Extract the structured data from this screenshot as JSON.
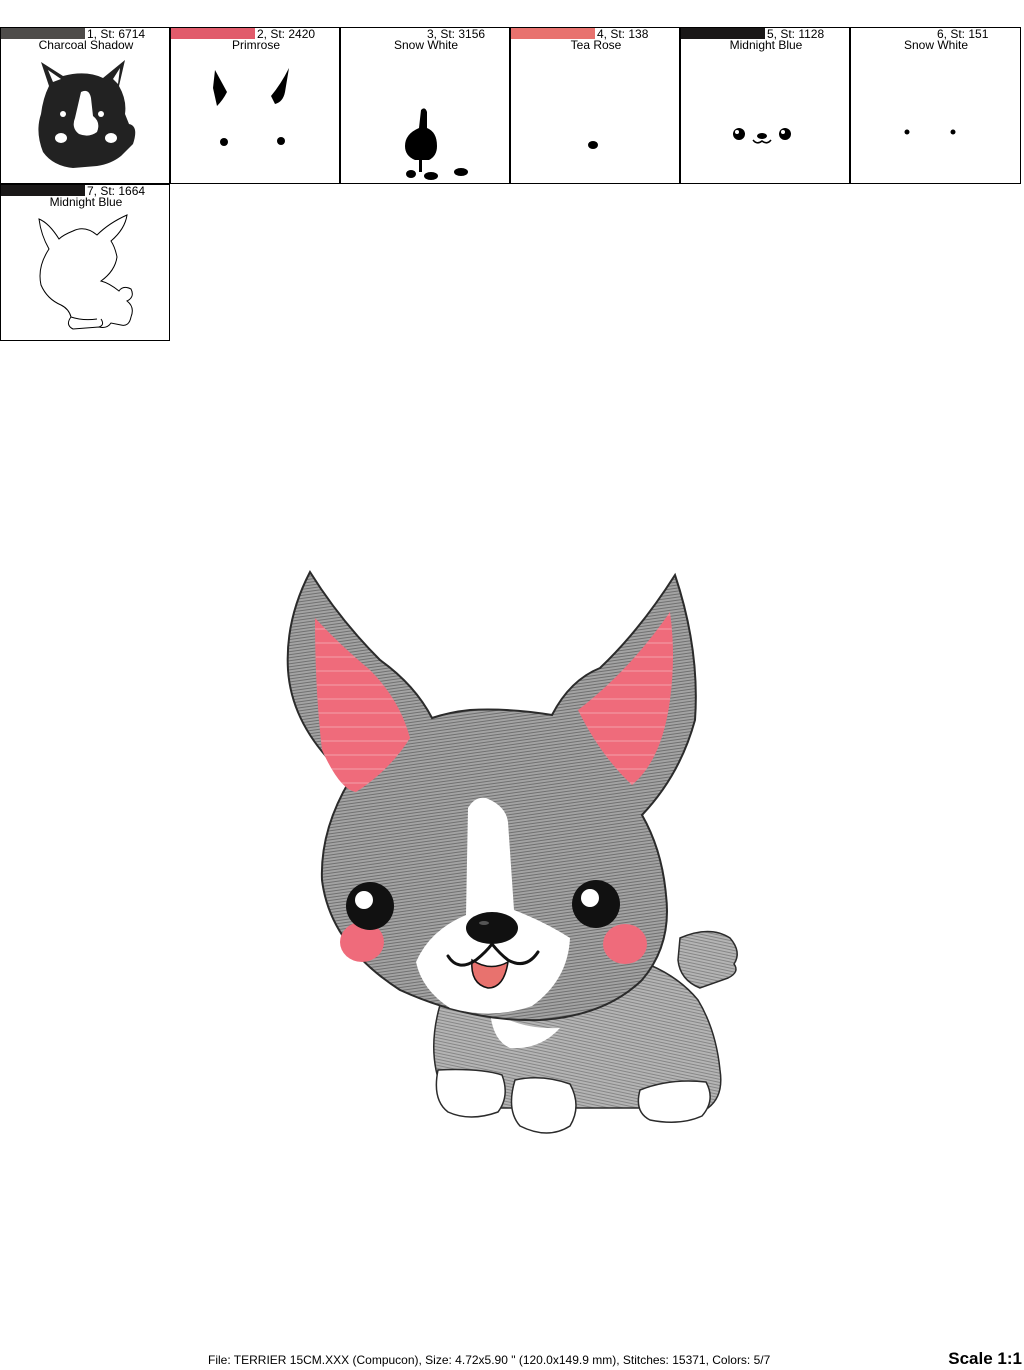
{
  "colors": [
    {
      "label": "1, St: 6714",
      "name": "Charcoal Shadow",
      "hex": "#4e4c4a",
      "icon": "dog-full-body-icon"
    },
    {
      "label": "2, St: 2420",
      "name": "Primrose",
      "hex": "#e15b6b",
      "icon": "ears-and-cheeks-icon"
    },
    {
      "label": "3, St: 3156",
      "name": "Snow White",
      "hex": "#ffffff",
      "icon": "blaze-and-paws-icon"
    },
    {
      "label": "4, St: 138",
      "name": "Tea Rose",
      "hex": "#e8726e",
      "icon": "tongue-icon"
    },
    {
      "label": "5, St: 1128",
      "name": "Midnight Blue",
      "hex": "#1a1818",
      "icon": "eyes-and-nose-icon"
    },
    {
      "label": "6, St: 151",
      "name": "Snow White",
      "hex": "#ffffff",
      "icon": "eye-highlights-icon"
    },
    {
      "label": "7, St: 1664",
      "name": "Midnight Blue",
      "hex": "#1a1818",
      "icon": "outline-icon"
    }
  ],
  "footer": "File: TERRIER 15CM.XXX (Compucon), Size: 4.72x5.90 \" (120.0x149.9 mm), Stitches: 15371, Colors: 5/7",
  "scale": "Scale 1:1"
}
